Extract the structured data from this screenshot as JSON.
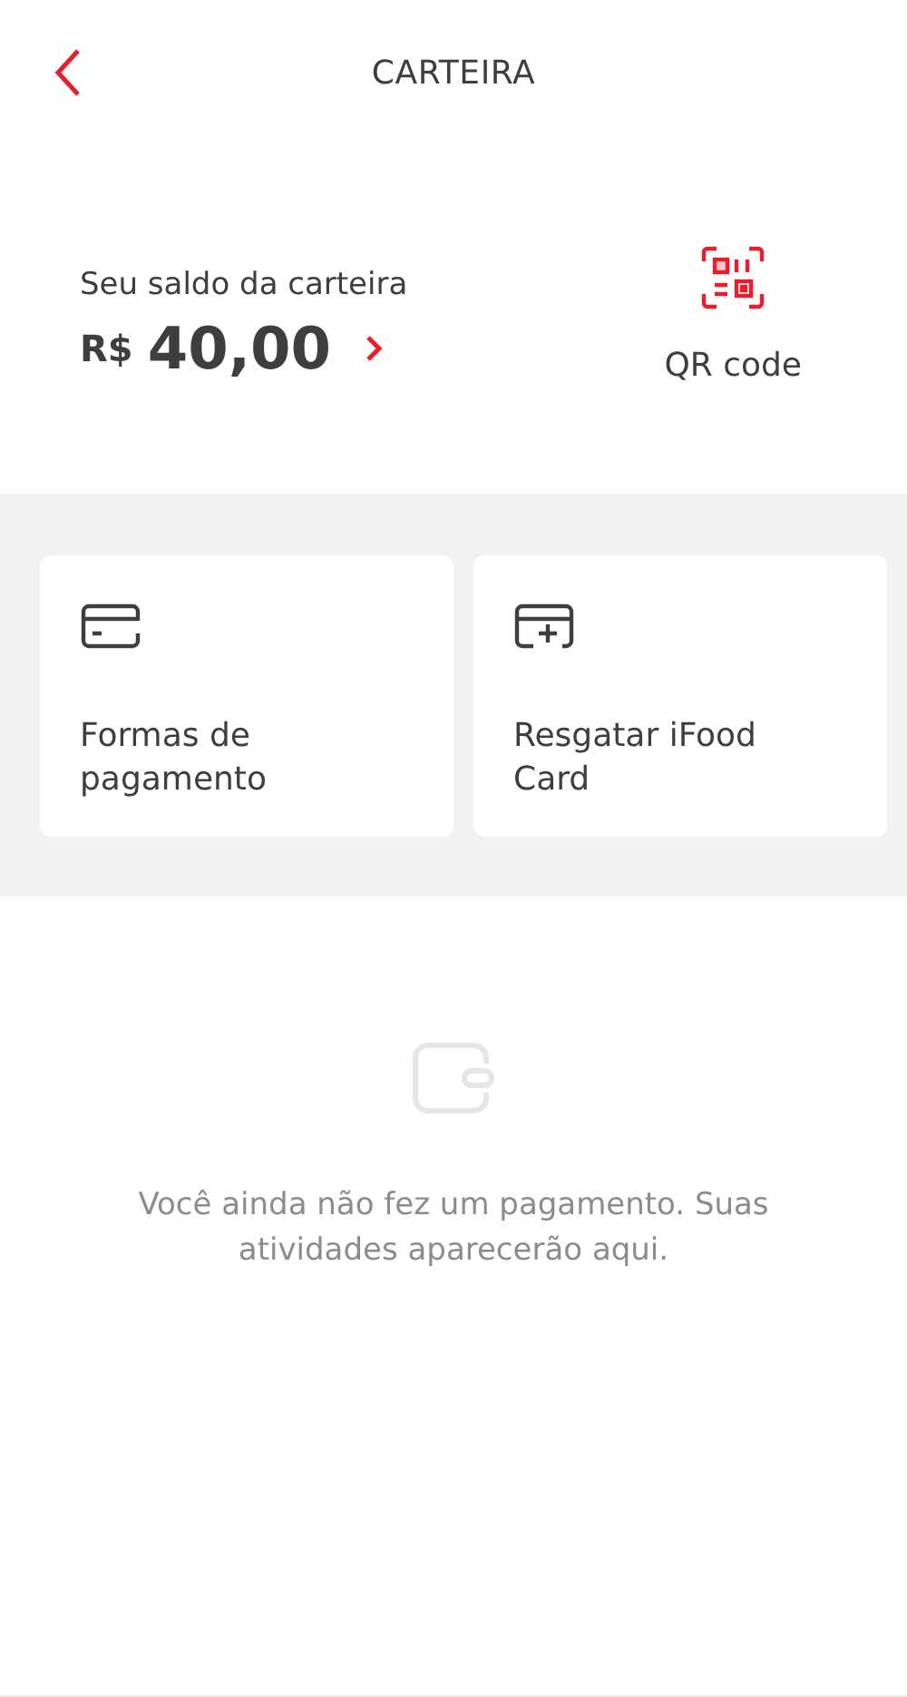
{
  "header": {
    "title": "CARTEIRA"
  },
  "balance": {
    "label": "Seu saldo da carteira",
    "currency": "R$",
    "amount": "40,00"
  },
  "qr": {
    "label": "QR code"
  },
  "actions": [
    {
      "kind": "card",
      "label": "Formas de pagamento"
    },
    {
      "kind": "redeem",
      "label": "Resgatar iFood Card"
    }
  ],
  "empty_state": {
    "message": "Você ainda não fez um pagamento. Suas atividades aparecerão aqui."
  }
}
